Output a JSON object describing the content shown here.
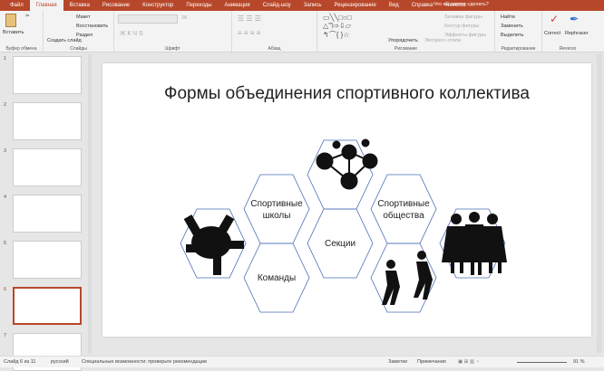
{
  "tabs": [
    "Файл",
    "Главная",
    "Вставка",
    "Рисование",
    "Конструктор",
    "Переходы",
    "Анимация",
    "Слайд-шоу",
    "Запись",
    "Рецензирование",
    "Вид",
    "Справка",
    "Reverso"
  ],
  "tell_me": "Что вы хотите сделать?",
  "ribbon": {
    "clipboard": {
      "paste": "Вставить",
      "label": "Буфер обмена"
    },
    "slides": {
      "new_slide": "Создать слайд",
      "layout": "Макет",
      "reset": "Восстановить",
      "section": "Раздел",
      "label": "Слайды"
    },
    "font": {
      "size": "28",
      "label": "Шрифт"
    },
    "paragraph": {
      "label": "Абзац"
    },
    "drawing": {
      "arrange": "Упорядочить",
      "quick_styles": "Экспресс-стили",
      "fill": "Заливка фигуры",
      "outline": "Контур фигуры",
      "effects": "Эффекты фигуры",
      "label": "Рисование"
    },
    "editing": {
      "find": "Найти",
      "replace": "Заменить",
      "select": "Выделить",
      "label": "Редактирование"
    },
    "reverso": {
      "correct": "Correct",
      "rephrase": "Rephraser",
      "label": "Reverso"
    }
  },
  "thumbnails": [
    {
      "n": "1"
    },
    {
      "n": "2"
    },
    {
      "n": "3"
    },
    {
      "n": "4"
    },
    {
      "n": "5"
    },
    {
      "n": "6"
    },
    {
      "n": "7"
    }
  ],
  "slide": {
    "title": "Формы объединения спортивного коллектива",
    "hex_labels": {
      "schools": "Спортивные школы",
      "societies": "Спортивные общества",
      "sections": "Секции",
      "teams": "Команды"
    }
  },
  "status": {
    "slide_of": "Слайд 6 из 11",
    "language": "русский",
    "accessibility": "Специальные возможности: проверьте рекомендации",
    "notes": "Заметки",
    "comments": "Примечания",
    "zoom": "91 %"
  },
  "colors": {
    "accent": "#b7472a",
    "hex_stroke": "#4a6fb5"
  }
}
